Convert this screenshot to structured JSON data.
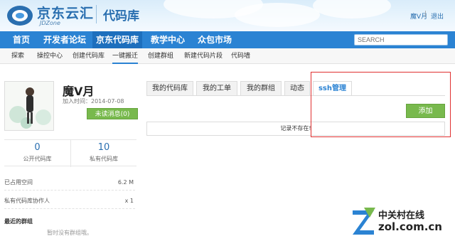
{
  "header": {
    "brand_cn": "京东云汇",
    "brand_en": "JDZone",
    "section": "代码库",
    "user_name": "魔V月",
    "separator": "|",
    "logout": "退出"
  },
  "main_nav": {
    "items": [
      {
        "label": "首页"
      },
      {
        "label": "开发者论坛"
      },
      {
        "label": "京东代码库",
        "active": true
      },
      {
        "label": "教学中心"
      },
      {
        "label": "众包市场"
      }
    ],
    "search_placeholder": "SEARCH"
  },
  "sub_nav": {
    "items": [
      {
        "label": "探索"
      },
      {
        "label": "操控中心"
      },
      {
        "label": "创建代码库"
      },
      {
        "label": "一键搬迁",
        "active": true
      },
      {
        "label": "创建群组"
      },
      {
        "label": "新建代码片段"
      },
      {
        "label": "代码墙"
      }
    ]
  },
  "profile": {
    "name": "魔V月",
    "join_label": "加入时间：",
    "join_date": "2014-07-08",
    "message_button": "未读消息(0)",
    "public_repo_count": "0",
    "public_repo_label": "公开代码库",
    "private_repo_count": "10",
    "private_repo_label": "私有代码库",
    "space_label": "已占用空间",
    "space_value": "6.2 M",
    "collab_label": "私有代码库协作人",
    "collab_value": "x 1",
    "groups_title": "最近的群组",
    "groups_empty": "暂时没有群组哦。"
  },
  "tabs": [
    {
      "label": "我的代码库"
    },
    {
      "label": "我的工单"
    },
    {
      "label": "我的群组"
    },
    {
      "label": "动态"
    },
    {
      "label": "ssh管理",
      "active": true
    }
  ],
  "content": {
    "add_button": "添加",
    "empty_message": "记录不存在!"
  },
  "watermark": {
    "line1": "中关村在线",
    "line2": "zol.com.cn"
  },
  "colors": {
    "nav_blue": "#2b83d3",
    "brand_blue": "#2a6fb0",
    "green_button": "#78b94d",
    "annotation_red": "#e03030"
  }
}
